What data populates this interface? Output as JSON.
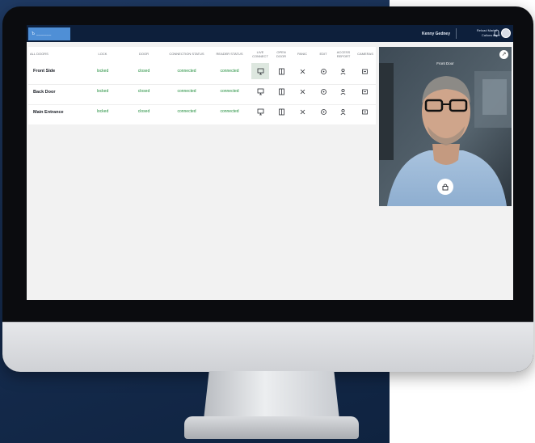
{
  "topbar": {
    "brand": "Ъ ______",
    "user": "Kenny Gedney",
    "note_line1": "Reload Marbo",
    "note_line2": "Callons Bs",
    "bell_icon": "bell-icon",
    "avatar_icon": "avatar"
  },
  "table": {
    "headers": [
      "ALL DOORS",
      "LOCK",
      "DOOR",
      "CONNECTION STATUS",
      "READER STATUS",
      "LIVE CONNECT",
      "OPEN DOOR",
      "PANIC",
      "EDIT",
      "ACCESS REPORT",
      "CAMERAS"
    ],
    "rows": [
      {
        "name": "Front Side",
        "lock": "locked",
        "door": "closed",
        "connection": "connected",
        "reader": "connected"
      },
      {
        "name": "Back Door",
        "lock": "locked",
        "door": "closed",
        "connection": "connected",
        "reader": "connected"
      },
      {
        "name": "Main Entrance",
        "lock": "locked",
        "door": "closed",
        "connection": "connected",
        "reader": "connected"
      }
    ],
    "action_icons": [
      "live-connect-icon",
      "open-door-icon",
      "panic-icon",
      "edit-icon",
      "access-report-icon",
      "camera-icon"
    ]
  },
  "video": {
    "label": "Front Door",
    "corner_icon": "expand-icon",
    "fab_icon": "lock-icon"
  },
  "colors": {
    "topbar": "#0d1f3b",
    "brand": "#4f8fd6",
    "status_green": "#1e8d3a",
    "active_cell": "#dde7df"
  }
}
